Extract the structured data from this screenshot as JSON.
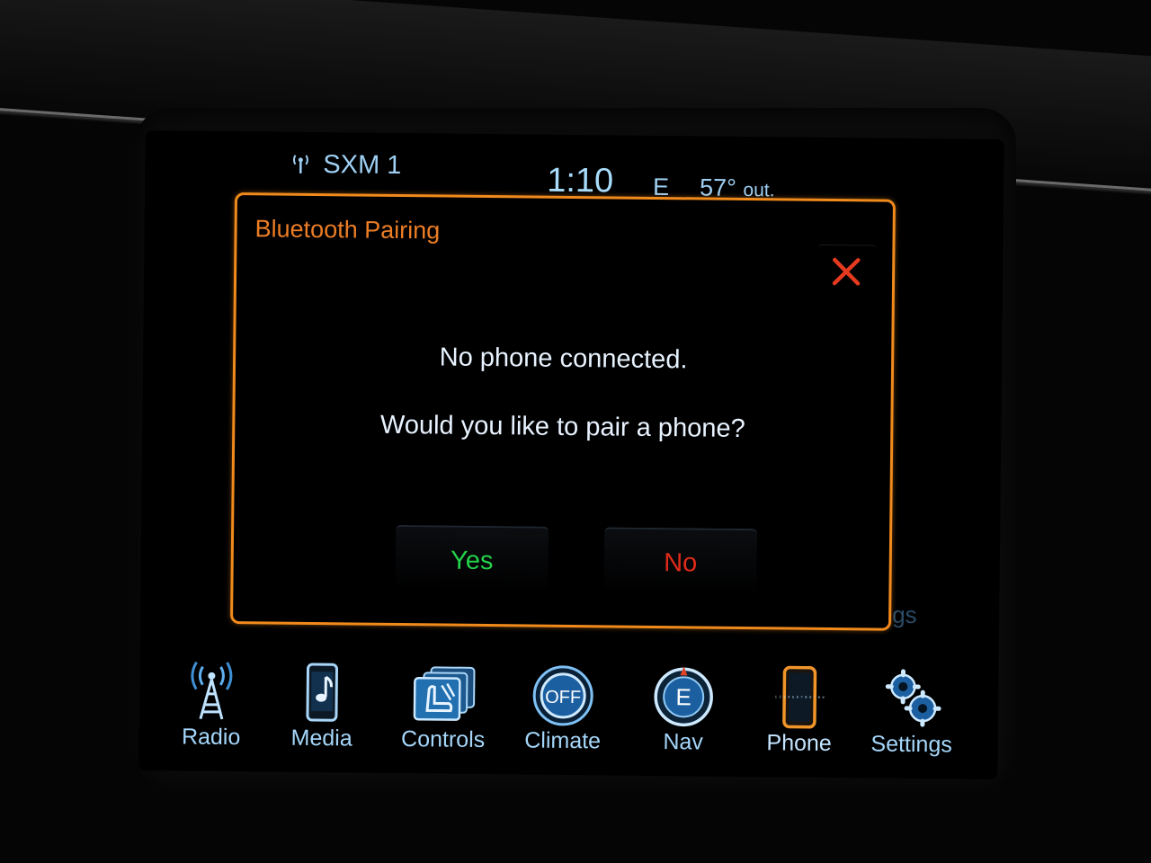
{
  "status": {
    "source": "SXM 1",
    "time": "1:10",
    "compass": "E",
    "temp_value": "57°",
    "temp_unit": "out.",
    "signal_icon": "antenna-signal-icon"
  },
  "dialog": {
    "title": "Bluetooth Pairing",
    "message_1": "No phone connected.",
    "message_2": "Would you like to pair a phone?",
    "yes_label": "Yes",
    "no_label": "No",
    "close_icon": "close-icon"
  },
  "background": {
    "partial_text": "gs"
  },
  "nav": {
    "items": [
      {
        "label": "Radio",
        "icon": "radio-tower-icon"
      },
      {
        "label": "Media",
        "icon": "media-phone-icon"
      },
      {
        "label": "Controls",
        "icon": "seat-controls-icon"
      },
      {
        "label": "Climate",
        "icon": "climate-off-icon",
        "badge": "OFF"
      },
      {
        "label": "Nav",
        "icon": "compass-icon",
        "badge": "E"
      },
      {
        "label": "Phone",
        "icon": "phone-keypad-icon",
        "keys": "1 2 3 4 5 6 7 8 9 * 0 #"
      },
      {
        "label": "Settings",
        "icon": "gears-icon"
      }
    ],
    "active": "Phone"
  },
  "colors": {
    "accent_orange": "#f08a1c",
    "text_blue": "#a5d6fa",
    "yes_green": "#24d24a",
    "no_red": "#e02a1a"
  }
}
